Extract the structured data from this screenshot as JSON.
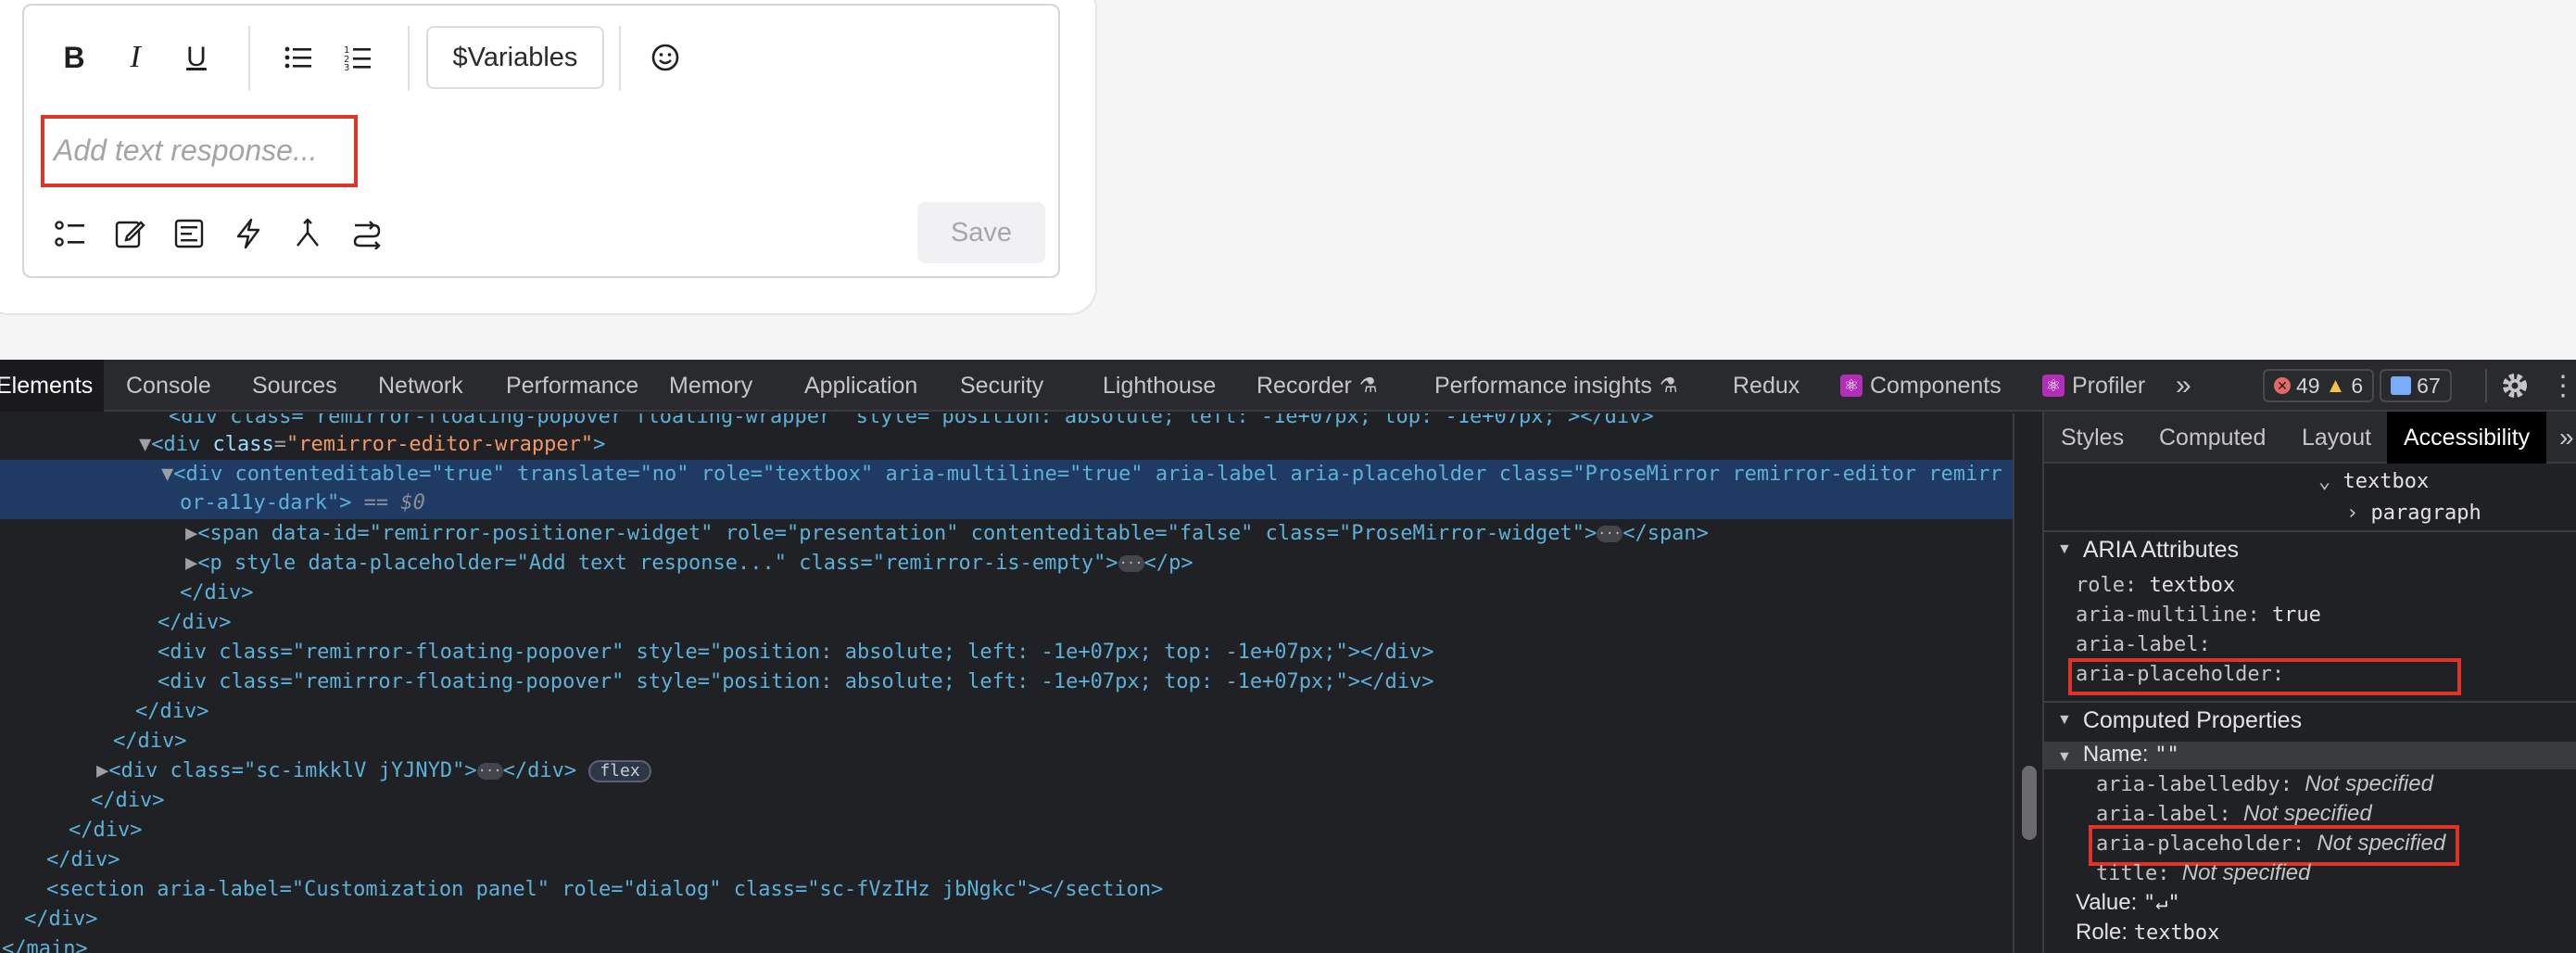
{
  "editor": {
    "toolbar": {
      "bold": "B",
      "italic": "I",
      "underline": "U",
      "variables_label": "$Variables"
    },
    "placeholder": "Add text response...",
    "save_label": "Save"
  },
  "devtools": {
    "tabs": [
      "Elements",
      "Console",
      "Sources",
      "Network",
      "Performance",
      "Memory",
      "Application",
      "Security",
      "Lighthouse",
      "Recorder",
      "Performance insights",
      "Redux",
      "Components",
      "Profiler"
    ],
    "more": "»",
    "errors": "49",
    "warnings": "6",
    "messages": "67",
    "code_lines": {
      "l0": "<div class=\"remirror-floating-popover floating-wrapper\" style=\"position: absolute; left: -1e+07px; top: -1e+07px;\"></div>",
      "l1_tag": "div",
      "l1_attr": "class",
      "l1_val": "\"remirror-editor-wrapper\"",
      "l2a": "<div contenteditable=\"true\" translate=\"no\" role=\"textbox\" aria-multiline=\"true\" aria-label aria-placeholder class=\"ProseMirror remirror-editor remirr",
      "l2b": "or-a11y-dark\">",
      "l2_ref": " == $0",
      "l3": "<span data-id=\"remirror-positioner-widget\" role=\"presentation\" contenteditable=\"false\" class=\"ProseMirror-widget\">",
      "l3_end": "</span>",
      "l4": "<p style data-placeholder=\"Add text response...\" class=\"remirror-is-empty\">",
      "l4_end": "</p>",
      "l5": "</div>",
      "l6": "</div>",
      "l7": "<div class=\"remirror-floating-popover\" style=\"position: absolute; left: -1e+07px; top: -1e+07px;\"></div>",
      "l8": "<div class=\"remirror-floating-popover\" style=\"position: absolute; left: -1e+07px; top: -1e+07px;\"></div>",
      "l9": "</div>",
      "l10": "</div>",
      "l11": "<div class=\"sc-imkklV jYJNYD\">",
      "l11_end": "</div>",
      "l11_pill": "flex",
      "l12": "</div>",
      "l13": "</div>",
      "l14": "</div>",
      "l15": "<section aria-label=\"Customization panel\" role=\"dialog\" class=\"sc-fVzIHz jbNgkc\"></section>",
      "l16": "</div>",
      "l17": "</main>"
    },
    "side_tabs": [
      "Styles",
      "Computed",
      "Layout",
      "Accessibility"
    ],
    "tree": {
      "textbox": "textbox",
      "paragraph": "paragraph"
    },
    "aria_section": "ARIA Attributes",
    "aria_attrs": [
      {
        "k": "role",
        "v": "textbox"
      },
      {
        "k": "aria-multiline",
        "v": "true"
      },
      {
        "k": "aria-label",
        "v": ""
      },
      {
        "k": "aria-placeholder",
        "v": ""
      }
    ],
    "computed_section": "Computed Properties",
    "name_label": "Name:",
    "name_value": "\"\"",
    "name_sources": [
      {
        "k": "aria-labelledby",
        "v": "Not specified"
      },
      {
        "k": "aria-label",
        "v": "Not specified"
      },
      {
        "k": "aria-placeholder",
        "v": "Not specified"
      },
      {
        "k": "title",
        "v": "Not specified"
      }
    ],
    "value_label": "Value:",
    "value_value": "\"↵\"",
    "role_label": "Role:",
    "role_value": "textbox"
  }
}
